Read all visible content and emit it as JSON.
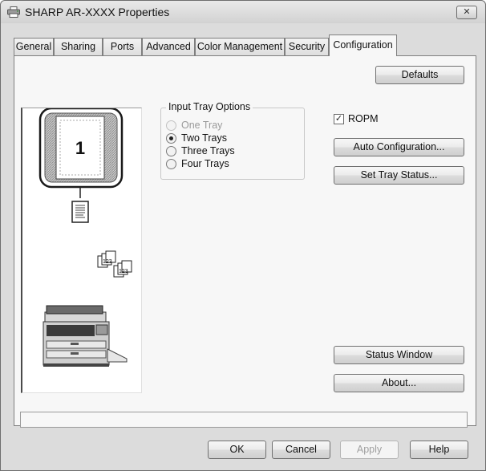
{
  "window": {
    "title": "SHARP AR-XXXX Properties",
    "close_label": "✕"
  },
  "tabs": [
    {
      "label": "General"
    },
    {
      "label": "Sharing"
    },
    {
      "label": "Ports"
    },
    {
      "label": "Advanced"
    },
    {
      "label": "Color Management"
    },
    {
      "label": "Security"
    },
    {
      "label": "Configuration",
      "active": true
    }
  ],
  "configuration": {
    "defaults_label": "Defaults",
    "preview": {
      "page_number": "1",
      "collate_digits": "123"
    },
    "input_tray_options": {
      "title": "Input Tray Options",
      "options": [
        {
          "label": "One Tray",
          "checked": false,
          "disabled": true
        },
        {
          "label": "Two Trays",
          "checked": true,
          "disabled": false
        },
        {
          "label": "Three Trays",
          "checked": false,
          "disabled": false
        },
        {
          "label": "Four Trays",
          "checked": false,
          "disabled": false
        }
      ]
    },
    "ropm": {
      "label": "ROPM",
      "checked": true,
      "mark": "✓"
    },
    "auto_configuration_label": "Auto Configuration...",
    "set_tray_status_label": "Set Tray Status...",
    "status_window_label": "Status Window",
    "about_label": "About..."
  },
  "footer": {
    "ok_label": "OK",
    "cancel_label": "Cancel",
    "apply_label": "Apply",
    "help_label": "Help"
  }
}
